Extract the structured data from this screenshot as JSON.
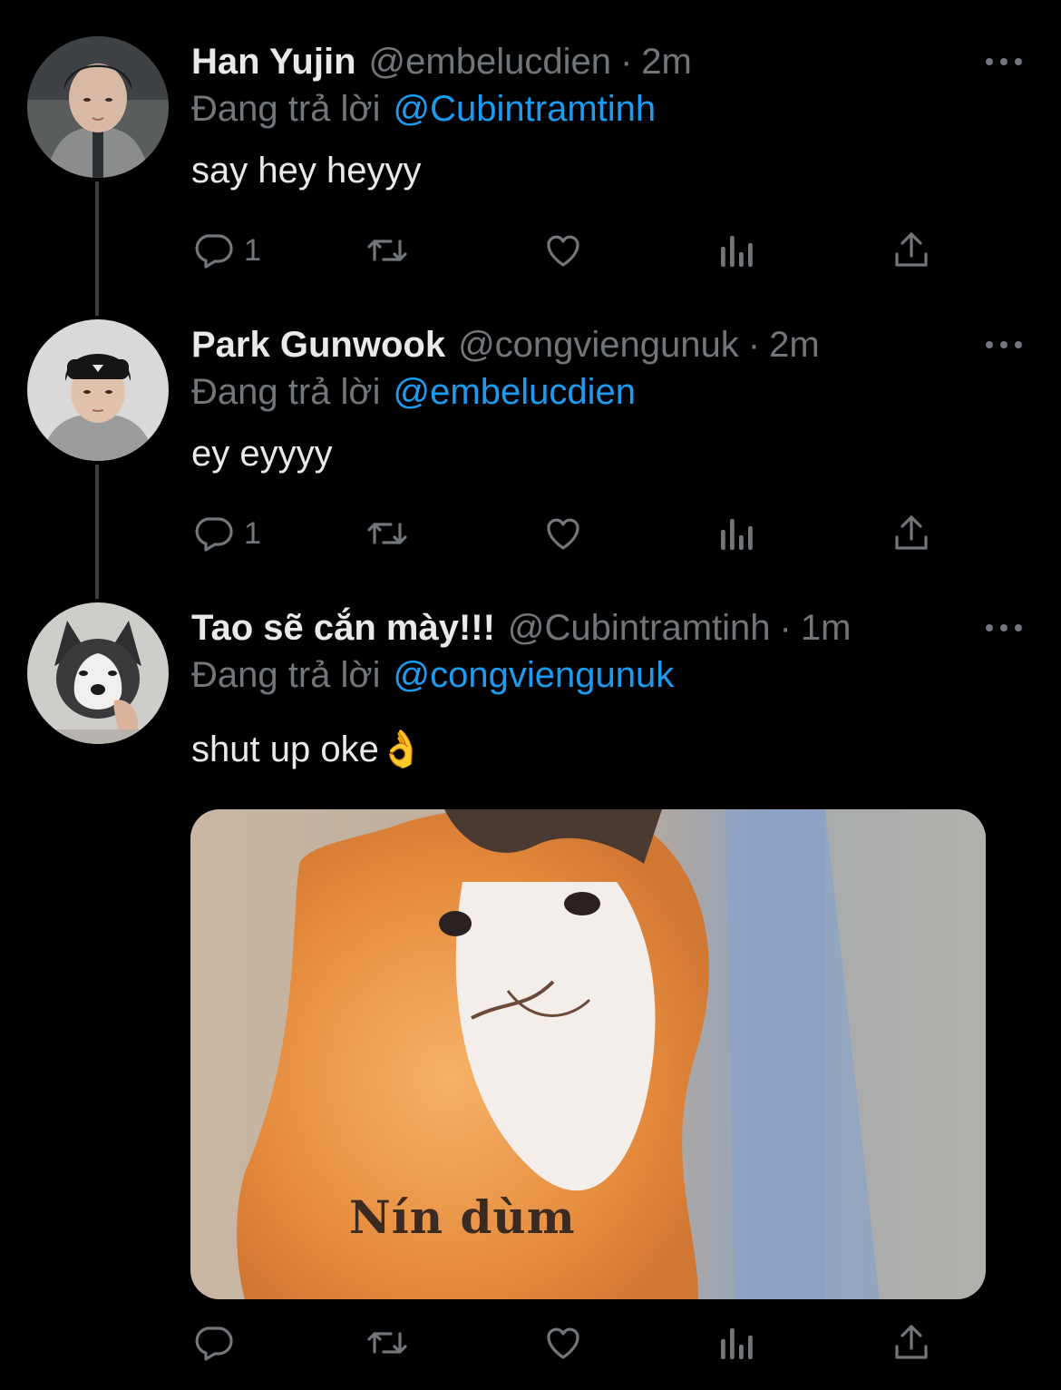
{
  "reply_prefix": "Đang trả lời",
  "tweets": [
    {
      "name": "Han Yujin",
      "handle": "@embelucdien",
      "separator": "·",
      "time": "2m",
      "reply_to": "@Cubintramtinh",
      "text": "say hey heyyy",
      "reply_count": "1"
    },
    {
      "name": "Park Gunwook",
      "handle": "@congviengunuk",
      "separator": "·",
      "time": "2m",
      "reply_to": "@embelucdien",
      "text": "ey eyyyy",
      "reply_count": "1"
    },
    {
      "name": "Tao sẽ cắn mày!!!",
      "handle": "@Cubintramtinh",
      "separator": "·",
      "time": "1m",
      "reply_to": "@congviengunuk",
      "text": "shut up oke👌",
      "reply_count": "",
      "media_caption": "Nín dùm"
    }
  ],
  "icons": {
    "reply": "reply-icon",
    "retweet": "retweet-icon",
    "like": "heart-icon",
    "views": "analytics-icon",
    "share": "share-icon",
    "more": "more-icon"
  },
  "colors": {
    "background": "#000000",
    "text": "#e7e9ea",
    "muted": "#71767b",
    "link": "#1d9bf0",
    "thread_line": "#3a3d40"
  }
}
